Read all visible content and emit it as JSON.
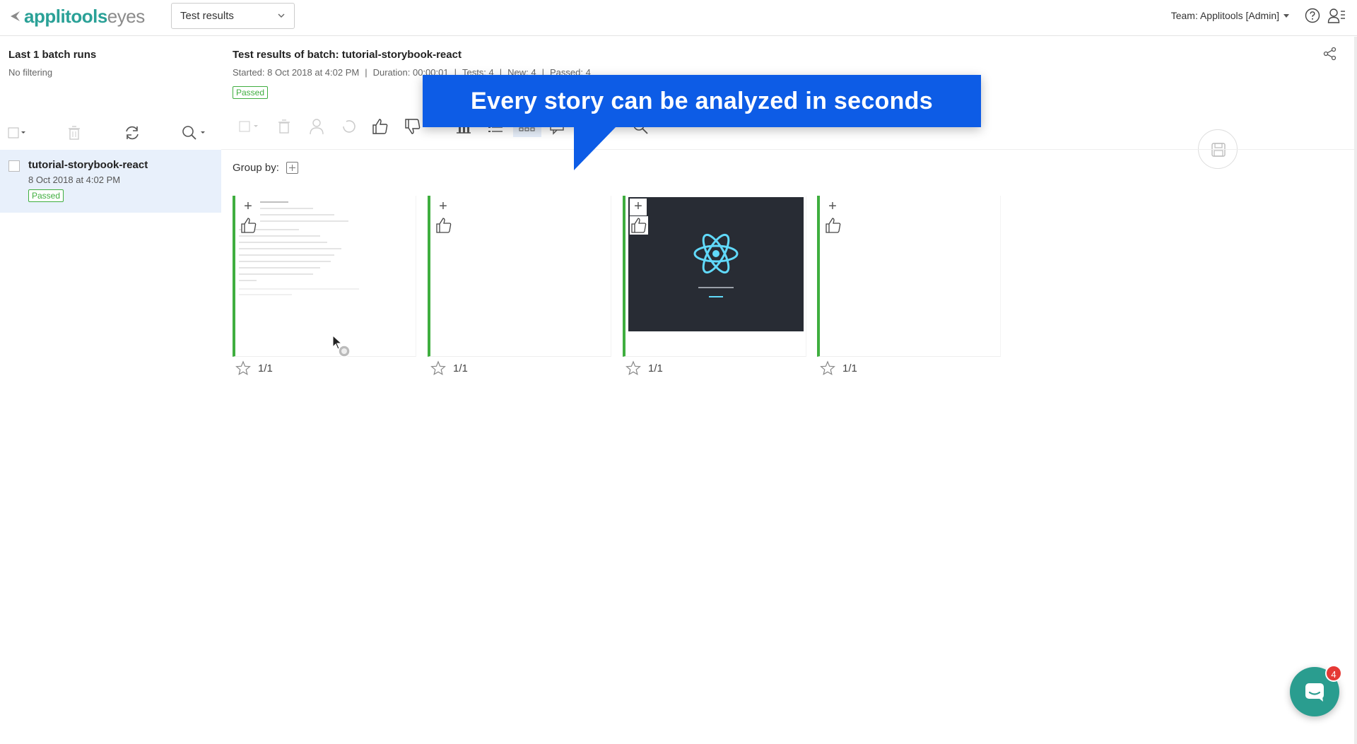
{
  "app": {
    "logo_main": "applitools",
    "logo_sub": "eyes",
    "view_select": "Test results",
    "team": "Team: Applitools  [Admin]"
  },
  "sidebar": {
    "title": "Last 1 batch runs",
    "filter": "No filtering",
    "batches": [
      {
        "name": "tutorial-storybook-react",
        "date": "8 Oct 2018 at 4:02 PM",
        "status": "Passed"
      }
    ]
  },
  "batch": {
    "title": "Test results of batch: tutorial-storybook-react",
    "started": "Started: 8 Oct 2018 at 4:02 PM",
    "duration": "Duration: 00:00:01",
    "tests": "Tests: 4",
    "new": "New: 4",
    "passed": "Passed: 4",
    "status": "Passed"
  },
  "group_by_label": "Group by:",
  "tooltip": "Every story can be analyzed in seconds",
  "cards": [
    {
      "steps": "1/1",
      "shot": "storybook-doc"
    },
    {
      "steps": "1/1",
      "shot": "blank"
    },
    {
      "steps": "1/1",
      "shot": "react-dark"
    },
    {
      "steps": "1/1",
      "shot": "blank"
    }
  ],
  "chat": {
    "unread": "4"
  },
  "colors": {
    "accent": "#2aa197",
    "passed": "#3fae3f",
    "tooltip": "#0d5ce6",
    "selected_row": "#e8f0fb"
  }
}
